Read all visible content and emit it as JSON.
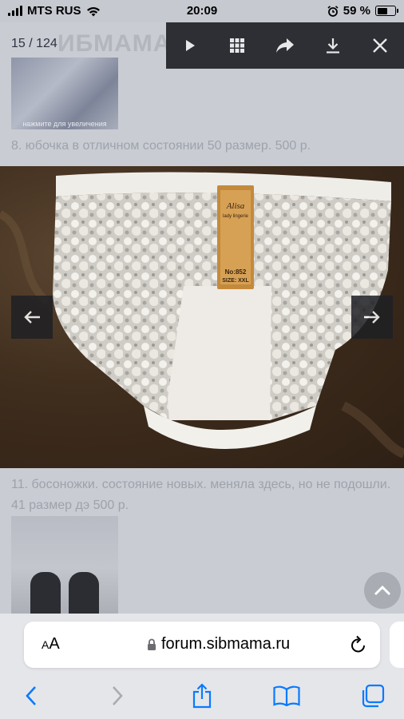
{
  "status_bar": {
    "carrier": "MTS RUS",
    "time": "20:09",
    "battery_percent": "59 %",
    "battery_level": 0.59,
    "icons": [
      "signal-icon",
      "wifi-icon",
      "alarm-icon",
      "battery-icon"
    ]
  },
  "lightbox": {
    "counter": "15 / 124",
    "toolbar": [
      "play-icon",
      "grid-icon",
      "share-icon",
      "download-icon",
      "close-icon"
    ],
    "prev_icon": "arrow-left-icon",
    "next_icon": "arrow-right-icon"
  },
  "page": {
    "logo_text": "ИБМАМА",
    "thumb_caption": "нажмите для увеличения",
    "post_8": "8. юбочка в отличном состоянии 50 размер. 500 р.",
    "post_11": "11. босоножки. состояние новых. меняла здесь, но не подошли. 41 размер дэ 500 р."
  },
  "photo": {
    "tag_brand": "Alisa",
    "tag_sub": "lady lingerie",
    "tag_no": "No:852",
    "tag_size": "SIZE: XXL"
  },
  "safari": {
    "aa_small": "A",
    "aa_large": "A",
    "url": "forum.sibmama.ru",
    "icons": [
      "lock-icon",
      "reload-icon",
      "back-icon",
      "forward-icon",
      "share-icon",
      "bookmarks-icon",
      "tabs-icon"
    ]
  },
  "colors": {
    "toolbar_bg": "#2d2f34",
    "ios_blue": "#0a7aff",
    "page_dim": "#c9ccd3"
  }
}
